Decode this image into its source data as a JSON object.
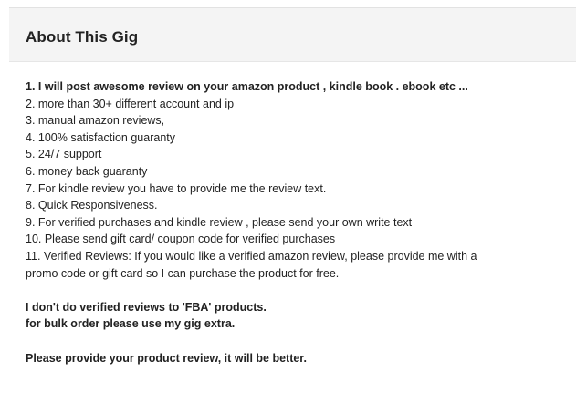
{
  "header": {
    "title": "About This Gig"
  },
  "description": {
    "list_items": [
      "1. I will post awesome review on your amazon  product , kindle book . ebook etc ...",
      "2. more than 30+ different account and ip",
      "3. manual amazon reviews,",
      "4. 100% satisfaction guaranty",
      "5. 24/7 support",
      "6.  money back guaranty",
      "7. For kindle review you have to provide me the review text.",
      "8. Quick Responsiveness.",
      "9. For verified purchases and kindle review , please send your own write text",
      "10. Please send gift card/ coupon code for verified purchases",
      "11. Verified Reviews: If you would like a verified amazon review, please provide me with a",
      "promo code or gift card so I can purchase the product for  free."
    ],
    "notes": [
      "I don't do verified reviews to 'FBA' products.",
      "for bulk order please use my gig extra."
    ],
    "closing": "Please provide your product review, it will be better."
  }
}
